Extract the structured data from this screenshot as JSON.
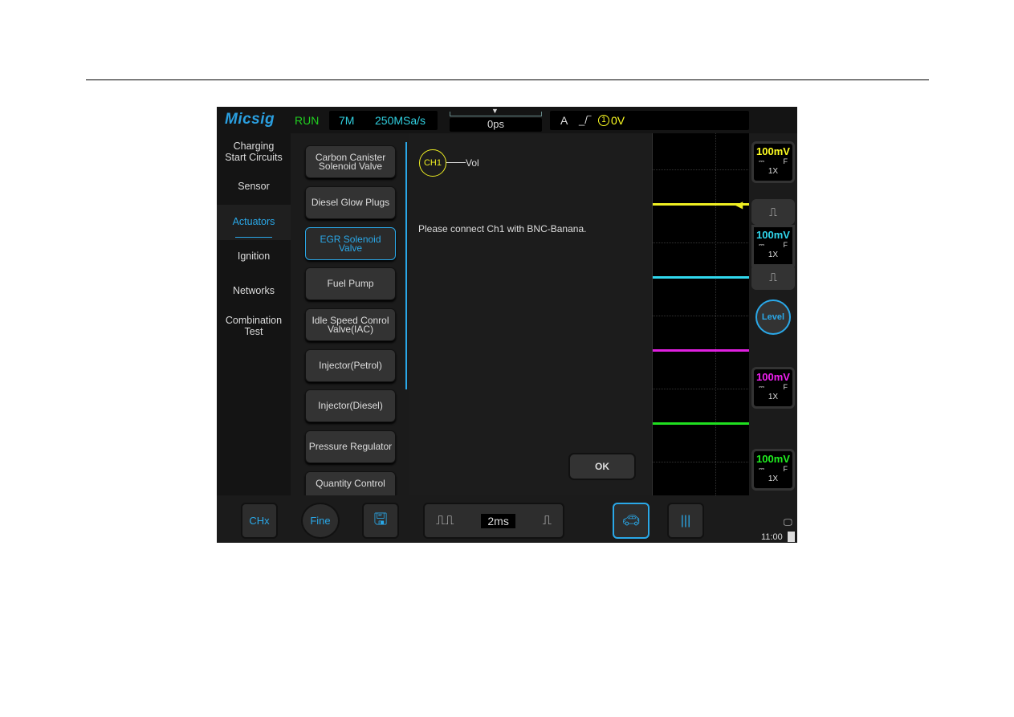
{
  "header": {
    "logo": "Micsig",
    "status": "RUN",
    "memory": "7M",
    "sample_rate": "250MSa/s",
    "time_offset": "0ps",
    "trigger_mode": "A",
    "trigger_level": "0V",
    "trigger_channel": "1"
  },
  "categories": [
    {
      "label": "Charging\nStart Circuits"
    },
    {
      "label": "Sensor"
    },
    {
      "label": "Actuators",
      "active": true
    },
    {
      "label": "Ignition"
    },
    {
      "label": "Networks"
    },
    {
      "label": "Combination\nTest"
    }
  ],
  "tests": [
    {
      "label": "Carbon Canister Solenoid Valve"
    },
    {
      "label": "Diesel Glow Plugs"
    },
    {
      "label": "EGR Solenoid Valve",
      "selected": true
    },
    {
      "label": "Fuel Pump"
    },
    {
      "label": "Idle Speed Conrol Valve(IAC)"
    },
    {
      "label": "Injector(Petrol)"
    },
    {
      "label": "Injector(Diesel)"
    },
    {
      "label": "Pressure Regulator"
    },
    {
      "label": "Quantity Control"
    }
  ],
  "dialog": {
    "channel": "CH1",
    "probe_label": "Vol",
    "message": "Please connect Ch1 with BNC-Banana.",
    "ok_label": "OK"
  },
  "channels": [
    {
      "scale": "100mV",
      "coupling": "F",
      "probe": "1X",
      "color": "#ffff20"
    },
    {
      "scale": "100mV",
      "coupling": "F",
      "probe": "1X",
      "color": "#30e0f0"
    },
    {
      "scale": "100mV",
      "coupling": "F",
      "probe": "1X",
      "color": "#f020f0"
    },
    {
      "scale": "100mV",
      "coupling": "F",
      "probe": "1X",
      "color": "#20f020"
    }
  ],
  "level_label": "Level",
  "bottom": {
    "chx": "CHx",
    "fine": "Fine",
    "timebase": "2ms",
    "clock": "11:00"
  }
}
